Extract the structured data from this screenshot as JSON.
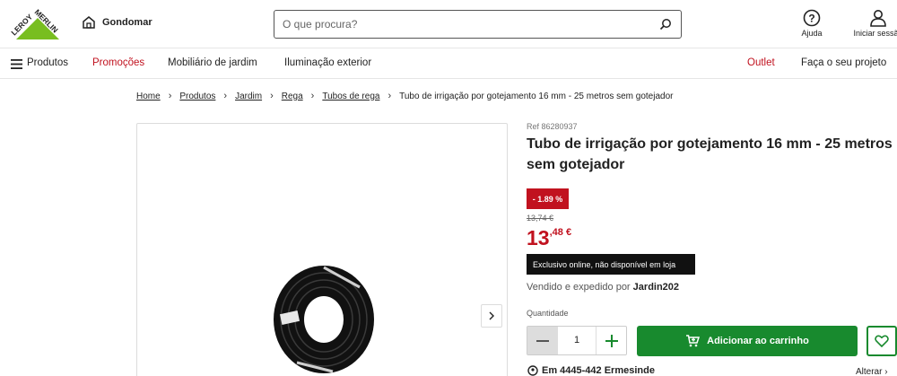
{
  "brand": {
    "logo_text": "LEROY MERLIN",
    "logo_color": "#78be20"
  },
  "header": {
    "store_name": "Gondomar",
    "search_placeholder": "O que procura?",
    "help_label": "Ajuda",
    "login_label": "Iniciar sessão"
  },
  "nav": {
    "menu_label": "Produtos",
    "items": [
      "Promoções",
      "Mobiliário de jardim",
      "Iluminação exterior"
    ],
    "outlet": "Outlet",
    "diy": "Faça o seu projeto"
  },
  "breadcrumb": [
    "Home",
    "Produtos",
    "Jardim",
    "Rega",
    "Tubos de rega",
    "Tubo de irrigação por gotejamento 16 mm - 25 metros sem gotejador"
  ],
  "product": {
    "ref": "Ref 86280937",
    "title": "Tubo de irrigação por gotejamento 16 mm - 25 metros sem gotejador",
    "discount": "- 1.89 %",
    "old_price": "13,74 €",
    "price_int": "13",
    "price_dec": ",48 €",
    "exclusive": "Exclusivo online, não disponível em loja",
    "seller_prefix": "Vendido e expedido por",
    "seller_name": "Jardin202",
    "quantity_label": "Quantidade",
    "quantity": "1",
    "add_to_cart": "Adicionar ao carrinho",
    "location": "Em 4445-442 Ermesinde",
    "change": "Alterar"
  },
  "colors": {
    "accent_red": "#c1121f",
    "cart_green": "#188a2e",
    "brand_green": "#78be20"
  },
  "icons": [
    "store-icon",
    "search-icon",
    "help-icon",
    "user-icon",
    "menu-icon",
    "chevron-right-icon",
    "minus-icon",
    "plus-icon",
    "cart-icon",
    "heart-icon",
    "location-pin-icon"
  ]
}
